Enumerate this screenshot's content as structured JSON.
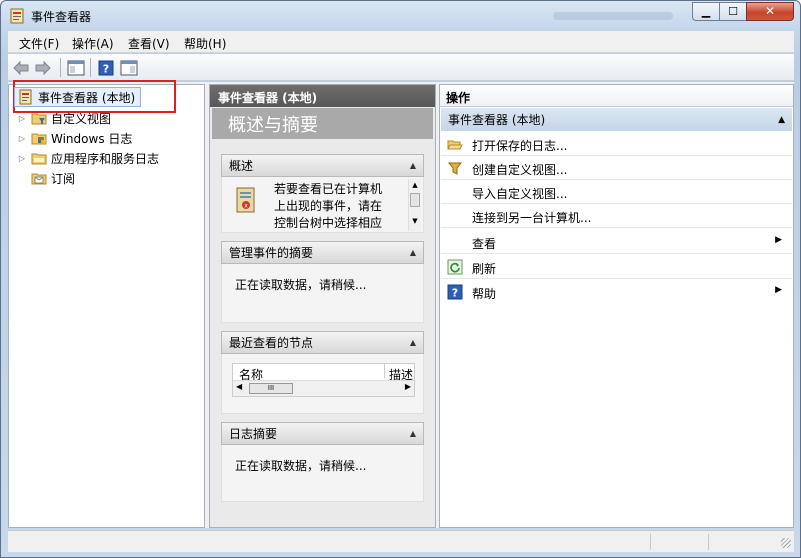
{
  "window": {
    "title": "事件查看器"
  },
  "menu": {
    "file": "文件(F)",
    "action": "操作(A)",
    "view": "查看(V)",
    "help": "帮助(H)"
  },
  "tree": {
    "root": "事件查看器 (本地)",
    "items": [
      {
        "label": "自定义视图",
        "icon": "folder-filter-icon"
      },
      {
        "label": "Windows 日志",
        "icon": "windows-log-icon"
      },
      {
        "label": "应用程序和服务日志",
        "icon": "folder-icon"
      },
      {
        "label": "订阅",
        "icon": "subscription-icon"
      }
    ]
  },
  "middle": {
    "header": "事件查看器 (本地)",
    "banner": "概述与摘要",
    "overview": {
      "title": "概述",
      "lines": [
        "若要查看已在计算机",
        "上出现的事件，请在",
        "控制台树中选择相应"
      ]
    },
    "admin_summary": {
      "title": "管理事件的摘要",
      "text": "正在读取数据，请稍候..."
    },
    "recent_nodes": {
      "title": "最近查看的节点",
      "col_name": "名称",
      "col_desc": "描述",
      "scroll_thumb": "III"
    },
    "log_summary": {
      "title": "日志摘要",
      "text": "正在读取数据，请稍候..."
    }
  },
  "actions": {
    "header": "操作",
    "group": "事件查看器 (本地)",
    "items": [
      {
        "label": "打开保存的日志...",
        "icon": "open-folder-icon",
        "submenu": false
      },
      {
        "label": "创建自定义视图...",
        "icon": "filter-icon",
        "submenu": false
      },
      {
        "label": "导入自定义视图...",
        "icon": "",
        "submenu": false
      },
      {
        "label": "连接到另一台计算机...",
        "icon": "",
        "submenu": false
      },
      {
        "label": "查看",
        "icon": "",
        "submenu": true
      },
      {
        "label": "刷新",
        "icon": "refresh-icon",
        "submenu": false
      },
      {
        "label": "帮助",
        "icon": "help-icon",
        "submenu": true
      }
    ]
  },
  "colors": {
    "highlight_box": "#e02020",
    "selected_bg": "#e5f0fb",
    "action_group_bg": "#c5d5e8"
  }
}
